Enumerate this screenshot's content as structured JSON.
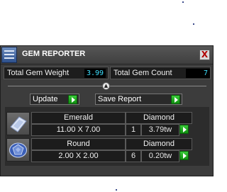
{
  "app": {
    "title": "GEM REPORTER",
    "close_glyph": "X",
    "icon": "report-list-icon"
  },
  "stats": {
    "weight_label": "Total Gem Weight",
    "weight_value": "3.99",
    "count_label": "Total Gem Count",
    "count_value": "7"
  },
  "collapse": {
    "glyph": "▲"
  },
  "actions": {
    "update_label": "Update",
    "save_label": "Save Report"
  },
  "gems": [
    {
      "shape": "Emerald",
      "size": "11.00 X 7.00",
      "material": "Diamond",
      "count": "1",
      "weight": "3.79tw",
      "thumb_icon": "emerald-cut-gem-icon"
    },
    {
      "shape": "Round",
      "size": "2.00 X 2.00",
      "material": "Diamond",
      "count": "6",
      "weight": "0.20tw",
      "thumb_icon": "round-cut-gem-icon"
    }
  ],
  "colors": {
    "panel_bg": "#3c3c3c",
    "value_text": "#3ee0ff",
    "go_button": "#1faa1f",
    "close_x": "#b00000"
  }
}
